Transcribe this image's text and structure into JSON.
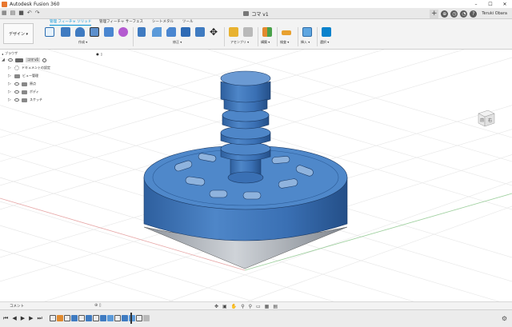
{
  "window": {
    "app_title": "Autodesk Fusion 360",
    "minimize": "–",
    "maximize": "☐",
    "close": "✕"
  },
  "tabs": {
    "document_title": "コマ v1",
    "close": "✕",
    "user_name": "Teruki Obara",
    "plus": "+"
  },
  "toolbar": {
    "workspace_label": "デザイン ▾",
    "tabs": [
      "管理 フィーチャ ソリッド",
      "管理フィーチャ サーフェス",
      "シートメタル",
      "ツール"
    ],
    "groups": [
      "作成 ▾",
      "修正 ▾",
      "アセンブリ ▾",
      "構築 ▾",
      "検査 ▾",
      "挿入 ▾",
      "選択 ▾"
    ],
    "accent_color": "#0696d7"
  },
  "browser": {
    "title": "ブラウザ",
    "root_label": "コマ v1",
    "items": [
      {
        "label": "ドキュメントの設定"
      },
      {
        "label": "ビュー管理"
      },
      {
        "label": "原点"
      },
      {
        "label": "ボディ"
      },
      {
        "label": "スケッチ"
      }
    ]
  },
  "viewcube": {
    "front_label": "前",
    "right_label": "右"
  },
  "comments": {
    "label": "コメント"
  },
  "model": {
    "body_color": "#3d74b8",
    "tip_color": "#b9bdc4"
  }
}
